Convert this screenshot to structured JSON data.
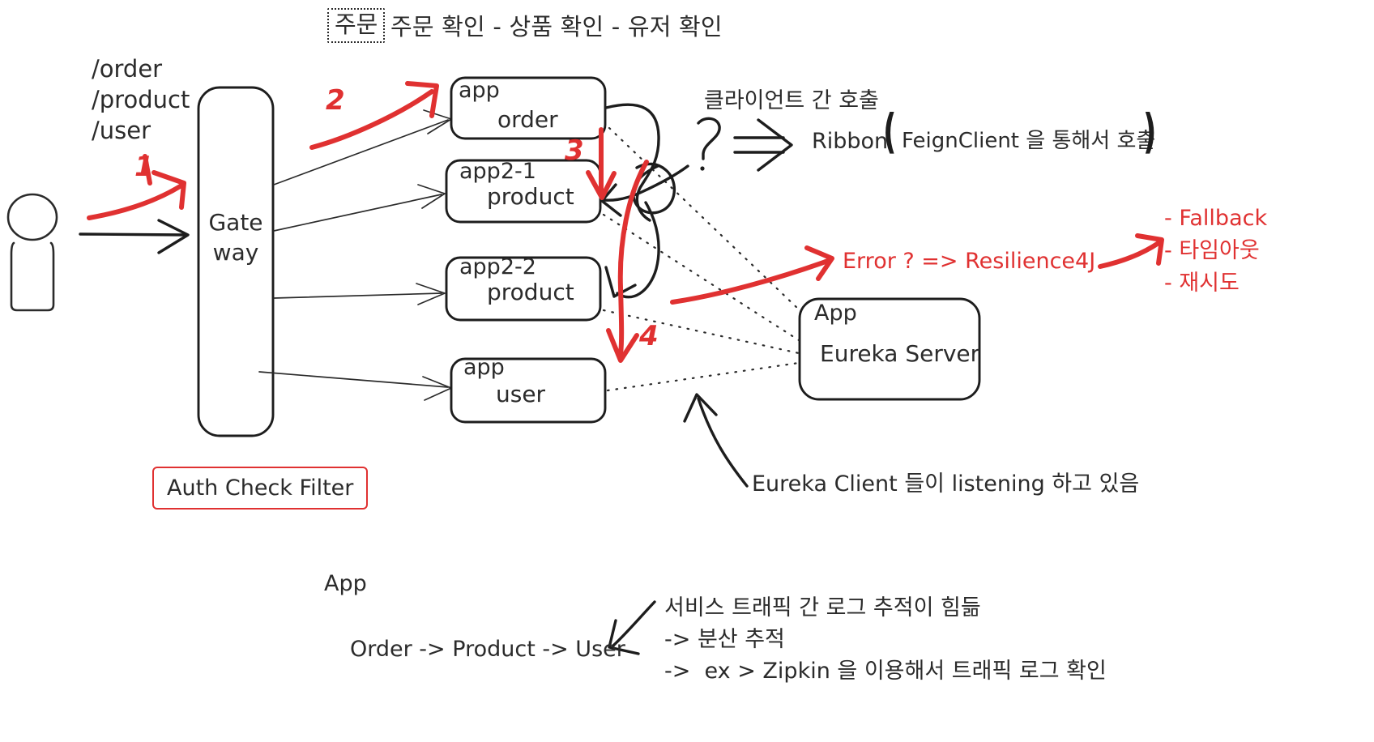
{
  "title": {
    "chip": "주문",
    "text": "주문 확인 - 상품 확인 - 유저 확인"
  },
  "routes": {
    "line1": "/order",
    "line2": "/product",
    "line3": "/user"
  },
  "gateway": {
    "line1": "Gate",
    "line2": "way"
  },
  "filter": {
    "label": "Auth Check Filter"
  },
  "services": [
    {
      "tag": "app",
      "name": "order"
    },
    {
      "tag": "app2-1",
      "name": "product"
    },
    {
      "tag": "app2-2",
      "name": "product"
    },
    {
      "tag": "app",
      "name": "user"
    }
  ],
  "eureka": {
    "tag": "App",
    "name": "Eureka Server",
    "client_note": "Eureka Client 들이 listening 하고 있음"
  },
  "steps": {
    "one": "1",
    "two": "2",
    "three": "3",
    "four": "4"
  },
  "notes": {
    "client_call": "클라이언트 간 호출",
    "ribbon": "Ribbon",
    "paren_open": "(",
    "feign": "FeignClient 을 통해서 호출",
    "paren_close": ")",
    "question": "?"
  },
  "resilience": {
    "error_text": "Error ?  => Resilience4J",
    "bullets": [
      "- Fallback",
      "- 타임아웃",
      "- 재시도"
    ]
  },
  "bottom": {
    "app_label": "App",
    "flow": "Order -> Product -> User",
    "tracing": [
      "서비스 트래픽 간 로그 추적이 힘듦",
      "-> 분산 추적",
      "->  ex > Zipkin 을 이용해서 트래픽 로그 확인"
    ]
  },
  "colors": {
    "ink": "#2b2b2b",
    "accent_red": "#e03131",
    "background": "#ffffff"
  },
  "icons": {
    "actor": "stick-figure-icon",
    "arrow": "arrow-icon",
    "dotted": "dotted-link-icon"
  }
}
